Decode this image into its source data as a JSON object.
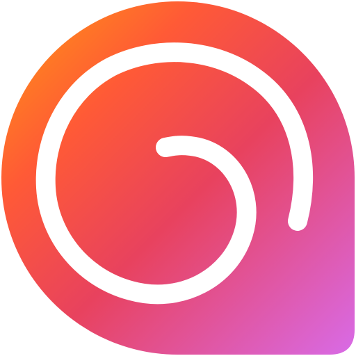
{
  "logo": {
    "icon_name": "spiral-logo-icon",
    "colors": {
      "gradient_start": "#FF9A12",
      "gradient_mid1": "#FF5A36",
      "gradient_mid2": "#E8425E",
      "gradient_end": "#D86BE8",
      "spiral": "#FFFFFF",
      "background": "#FFFFFF"
    }
  }
}
